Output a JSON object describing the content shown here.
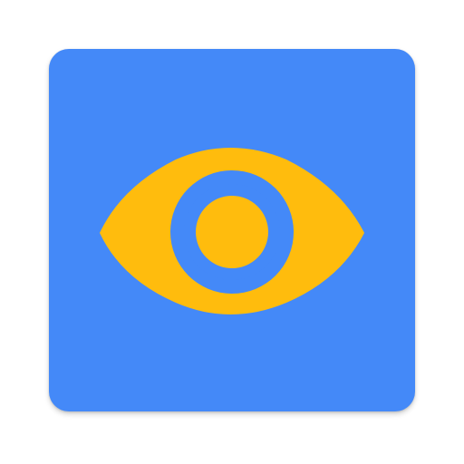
{
  "app_icon": {
    "icon": "eye-icon",
    "colors": {
      "tile_background": "#4489f8",
      "eye_fill": "#ffbc0d",
      "iris_ring": "#4489f8"
    }
  }
}
